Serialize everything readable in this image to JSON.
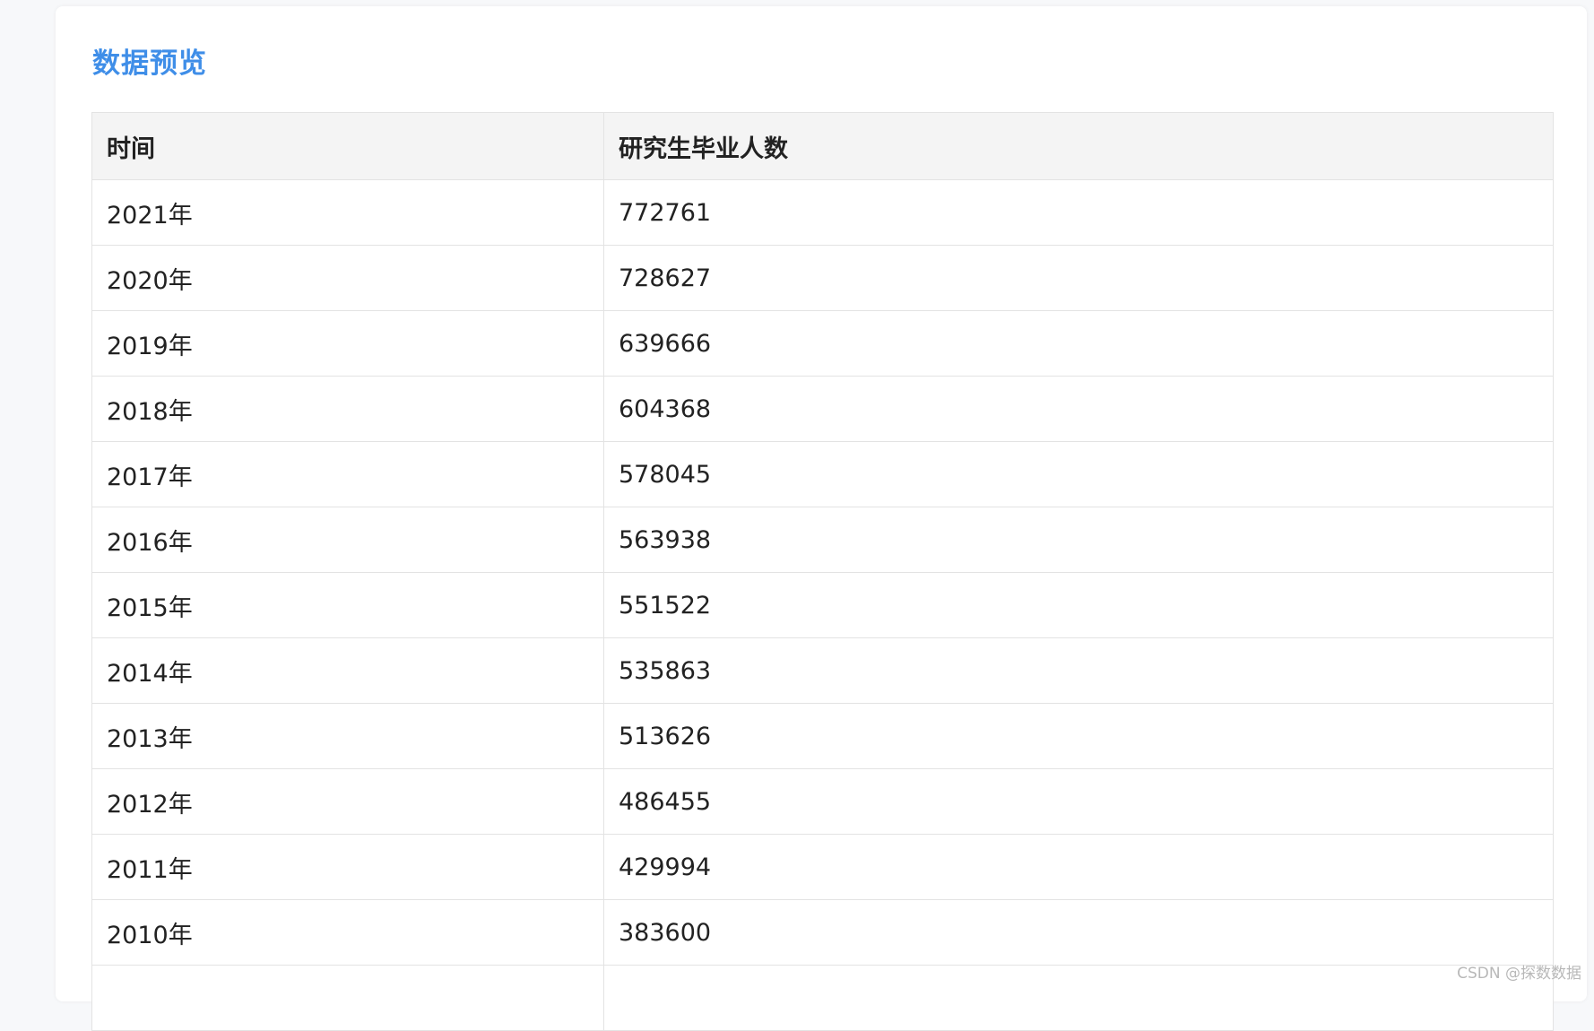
{
  "section": {
    "title": "数据预览"
  },
  "table": {
    "headers": [
      "时间",
      "研究生毕业人数"
    ],
    "rows": [
      [
        "2021年",
        "772761"
      ],
      [
        "2020年",
        "728627"
      ],
      [
        "2019年",
        "639666"
      ],
      [
        "2018年",
        "604368"
      ],
      [
        "2017年",
        "578045"
      ],
      [
        "2016年",
        "563938"
      ],
      [
        "2015年",
        "551522"
      ],
      [
        "2014年",
        "535863"
      ],
      [
        "2013年",
        "513626"
      ],
      [
        "2012年",
        "486455"
      ],
      [
        "2011年",
        "429994"
      ],
      [
        "2010年",
        "383600"
      ],
      [
        "",
        ""
      ]
    ]
  },
  "watermark": {
    "text": "CSDN @探数数据"
  },
  "colors": {
    "title": "#3f8ee8",
    "header_bg": "#f4f4f4",
    "border": "#e3e3e3",
    "text": "#222222"
  }
}
